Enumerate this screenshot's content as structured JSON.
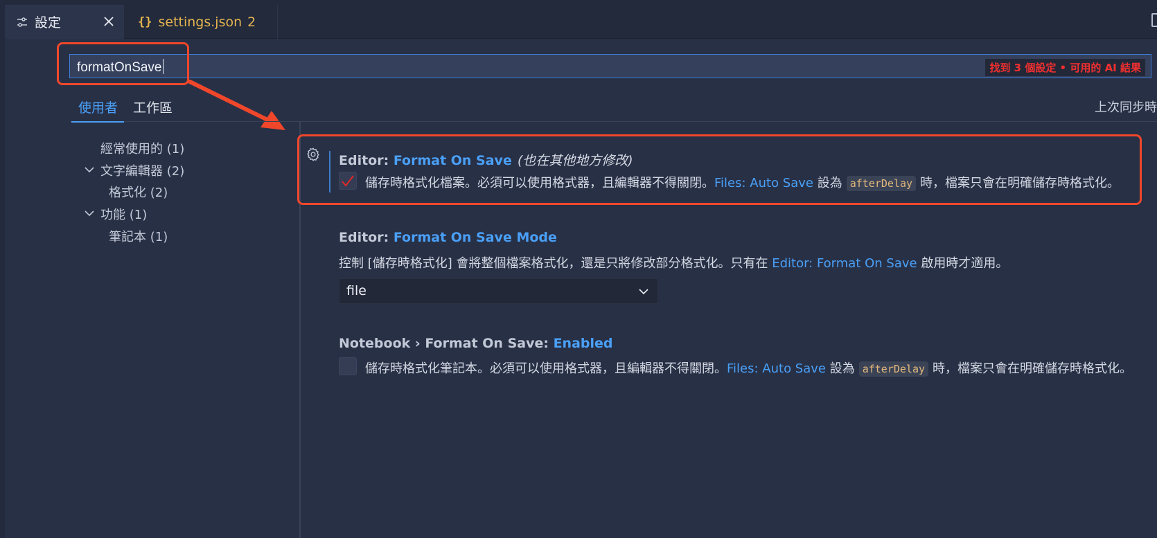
{
  "tabs": {
    "settings_label": "設定",
    "json_label": "settings.json",
    "json_count": "2"
  },
  "search": {
    "value": "formatOnSave",
    "result_count": "找到 3 個設定 • 可用的 AI 結果"
  },
  "scope": {
    "user": "使用者",
    "workspace": "工作區",
    "sync": "上次同步時"
  },
  "toc": {
    "items": [
      {
        "label": "經常使用的 (1)"
      },
      {
        "label": "文字編輯器 (2)"
      },
      {
        "label": "格式化 (2)"
      },
      {
        "label": "功能 (1)"
      },
      {
        "label": "筆記本 (1)"
      }
    ]
  },
  "settings": [
    {
      "category": "Editor: ",
      "name": "Format On Save",
      "note": "(也在其他地方修改)",
      "desc_pre": "儲存時格式化檔案。必須可以使用格式器，且編輯器不得關閉。",
      "desc_link": "Files: Auto Save",
      "desc_mid": " 設為",
      "desc_code": "afterDelay",
      "desc_post": "時，檔案只會在明確儲存時格式化。",
      "checked": true
    },
    {
      "category": "Editor: ",
      "name": "Format On Save Mode",
      "desc_pre": "控制 [儲存時格式化] 會將整個檔案格式化，還是只將修改部分格式化。只有在 ",
      "desc_link": "Editor: Format On Save",
      "desc_post": " 啟用時才適用。",
      "select_value": "file"
    },
    {
      "category": "Notebook › Format On Save: ",
      "name": "Enabled",
      "desc_pre": "儲存時格式化筆記本。必須可以使用格式器，且編輯器不得關閉。",
      "desc_link": "Files: Auto Save",
      "desc_mid": " 設為",
      "desc_code": "afterDelay",
      "desc_post": "時，檔案只會在明確儲存時格式化。",
      "checked": false
    }
  ],
  "colors": {
    "accent": "#4aa0f7",
    "annotation": "#f0472b",
    "background": "#283046"
  }
}
